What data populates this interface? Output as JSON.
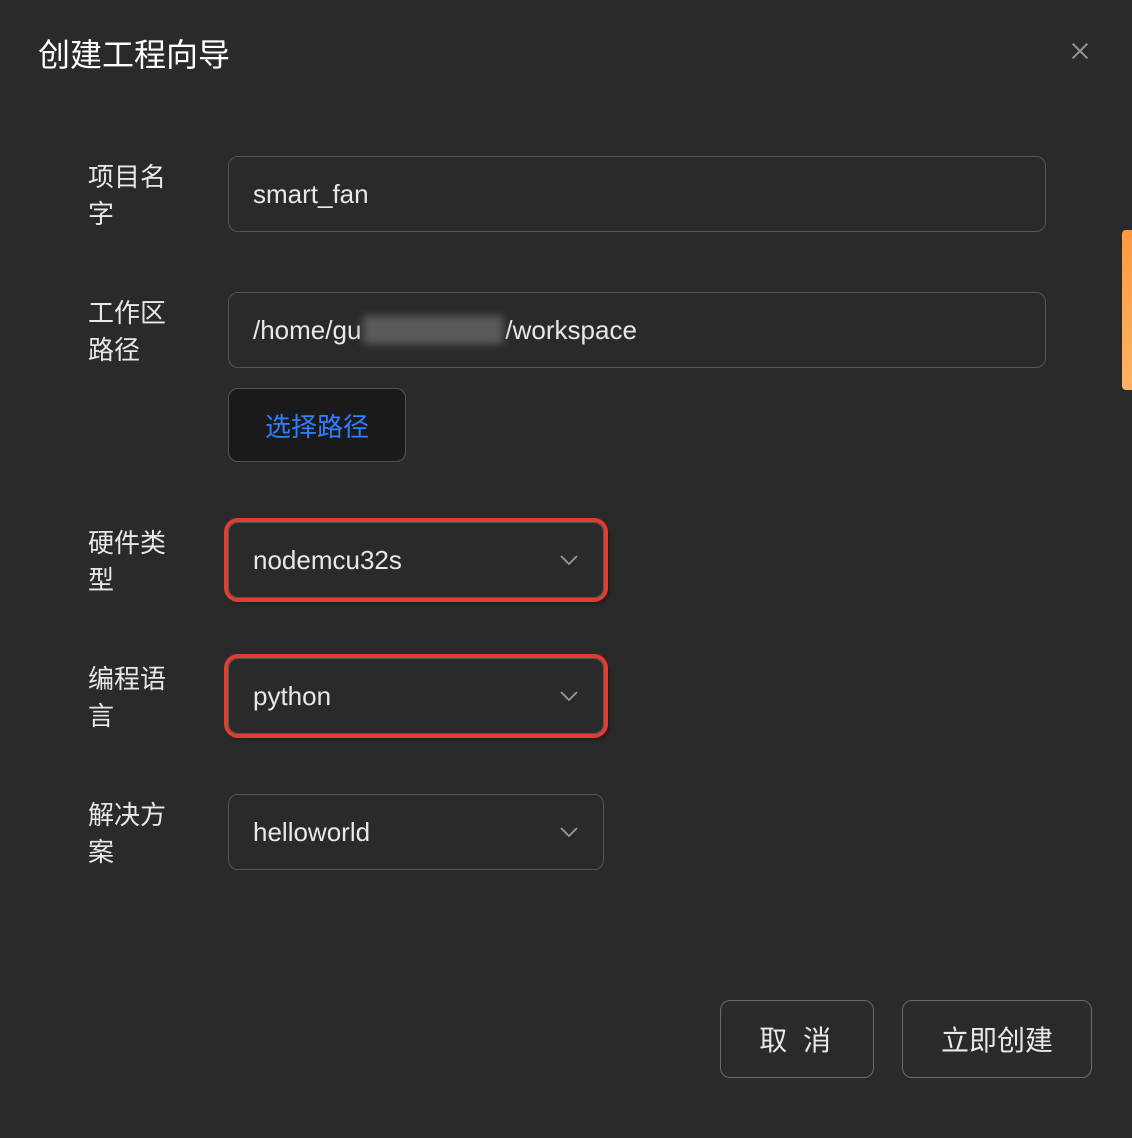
{
  "dialog": {
    "title": "创建工程向导"
  },
  "form": {
    "project_name_label": "项目名字",
    "project_name_value": "smart_fan",
    "workspace_label": "工作区路径",
    "workspace_prefix": "/home/gu",
    "workspace_suffix": "/workspace",
    "select_path_button": "选择路径",
    "hardware_label": "硬件类型",
    "hardware_value": "nodemcu32s",
    "language_label": "编程语言",
    "language_value": "python",
    "solution_label": "解决方案",
    "solution_value": "helloworld"
  },
  "footer": {
    "cancel": "取 消",
    "create": "立即创建"
  }
}
